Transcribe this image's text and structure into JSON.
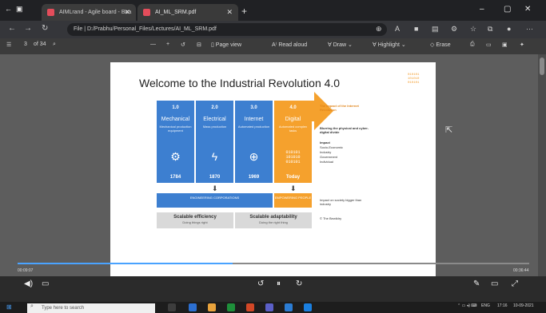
{
  "browser": {
    "tabs": [
      {
        "title": "AIMLrand ‑ Agile board ‑ Boa",
        "favicon_color": "#e44d5b"
      },
      {
        "title": "AI_ML_SRM.pdf",
        "favicon_color": "#e44d5b"
      }
    ],
    "new_tab": "+",
    "window_buttons": {
      "minimize": "‒",
      "restore": "▢",
      "close": "✕"
    },
    "address": "File | D:/Prabhu/Personal_Files/Lectures/AI_ML_SRM.pdf"
  },
  "pdf_toolbar": {
    "page_input": "3",
    "page_total": "of 34",
    "zoom_out": "—",
    "zoom_in": "+",
    "page_view": "Page view",
    "read_aloud": "Read aloud",
    "draw": "Draw",
    "highlight": "Highlight",
    "erase": "Erase"
  },
  "slide": {
    "title": "Welcome to the Industrial Revolution 4.0",
    "logo_lines": [
      "010101",
      "101010",
      "010101"
    ],
    "columns": [
      {
        "num": "1.0",
        "name": "Mechanical",
        "sub": "Mechanical production equipment",
        "icon": "⚙",
        "year": "1784"
      },
      {
        "num": "2.0",
        "name": "Electrical",
        "sub": "Mass production",
        "icon": "ϟ",
        "year": "1870"
      },
      {
        "num": "3.0",
        "name": "Internet",
        "sub": "Automated production",
        "icon": "⊕",
        "year": "1969"
      },
      {
        "num": "4.0",
        "name": "Digital",
        "sub": "Automated complex tasks",
        "icon": "010101 101010 010101",
        "year": "Today"
      }
    ],
    "arrow_text": "The impact of the Internet Revolution",
    "right_notes": [
      "Blurring the physical and cyber-digital divide",
      "Impact",
      "Socio-Economic",
      "Industry",
      "Government",
      "Individual"
    ],
    "bottom_right_notes": [
      "Impact on society bigger than industry",
      "© The Bewildry"
    ],
    "bars": [
      {
        "label": "ENGINEERING CORPORATIONS",
        "color": "#3d7fd0"
      },
      {
        "label": "EMPOWERING PEOPLE",
        "color": "#f5a12d"
      }
    ],
    "grey_boxes": [
      {
        "title": "Scalable efficiency",
        "sub": "Doing things right"
      },
      {
        "title": "Scalable adaptability",
        "sub": "Doing the right thing"
      }
    ]
  },
  "video": {
    "time_left": "00:09:07",
    "time_right": "00:36:44",
    "progress": 0.42
  },
  "taskbar": {
    "search_placeholder": "Type here to search",
    "time": "17:16",
    "date": "10-09-2021",
    "lang": "ENG"
  }
}
